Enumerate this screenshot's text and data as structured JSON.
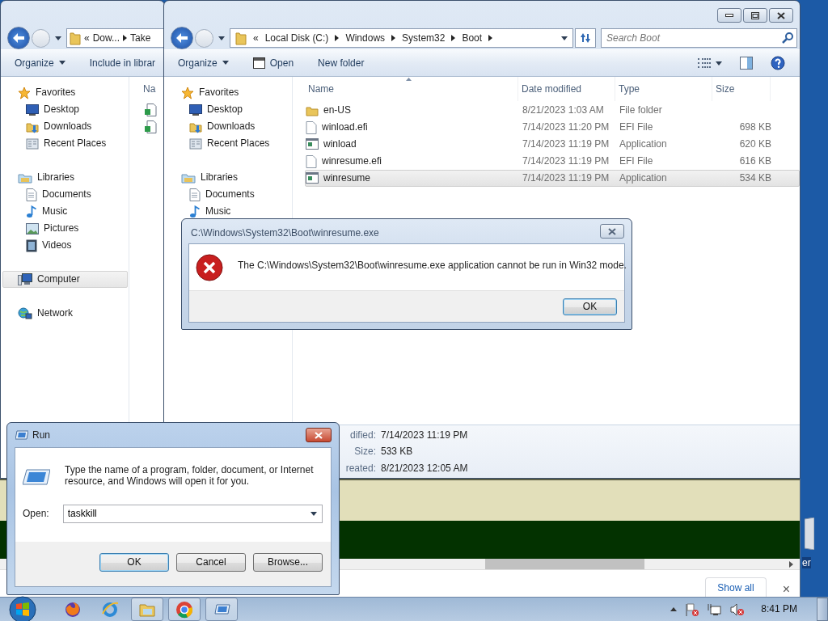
{
  "back_explorer": {
    "address": {
      "overflow": "«",
      "crumbs": [
        "Dow...",
        "Take"
      ]
    },
    "toolbar": [
      {
        "label": "Organize",
        "dropdown": true
      },
      {
        "label": "Include in librar",
        "dropdown": false
      }
    ],
    "nav": [
      {
        "label": "Favorites",
        "kind": "star",
        "selected": false,
        "children": [
          {
            "label": "Desktop",
            "kind": "desktop",
            "selected": false
          },
          {
            "label": "Downloads",
            "kind": "downloads",
            "selected": false
          },
          {
            "label": "Recent Places",
            "kind": "recent",
            "selected": false
          }
        ]
      },
      {
        "label": "Libraries",
        "kind": "library",
        "selected": false,
        "children": [
          {
            "label": "Documents",
            "kind": "documents",
            "selected": false
          },
          {
            "label": "Music",
            "kind": "music",
            "selected": false
          },
          {
            "label": "Pictures",
            "kind": "pictures",
            "selected": false
          },
          {
            "label": "Videos",
            "kind": "videos",
            "selected": false
          }
        ]
      },
      {
        "label": "Computer",
        "kind": "computer",
        "selected": true
      },
      {
        "label": "Network",
        "kind": "network",
        "selected": false
      }
    ],
    "column_1": "Na",
    "files": [
      {
        "kind": "script"
      },
      {
        "kind": "script"
      }
    ]
  },
  "front_explorer": {
    "address": {
      "overflow": "«",
      "crumbs": [
        "Local Disk (C:)",
        "Windows",
        "System32",
        "Boot"
      ]
    },
    "search": {
      "placeholder": "Search Boot"
    },
    "toolbar": [
      {
        "label": "Organize",
        "dropdown": true,
        "kind": "plain"
      },
      {
        "label": "Open",
        "dropdown": false,
        "kind": "open"
      },
      {
        "label": "New folder",
        "dropdown": false,
        "kind": "plain"
      }
    ],
    "nav": [
      {
        "label": "Favorites",
        "kind": "star",
        "selected": false,
        "children": [
          {
            "label": "Desktop",
            "kind": "desktop",
            "selected": false
          },
          {
            "label": "Downloads",
            "kind": "downloads",
            "selected": false
          },
          {
            "label": "Recent Places",
            "kind": "recent",
            "selected": false
          }
        ]
      },
      {
        "label": "Libraries",
        "kind": "library",
        "selected": false,
        "children": [
          {
            "label": "Documents",
            "kind": "documents",
            "selected": false
          },
          {
            "label": "Music",
            "kind": "music",
            "selected": false
          }
        ]
      }
    ],
    "columns": [
      "Name",
      "Date modified",
      "Type",
      "Size"
    ],
    "files": [
      {
        "name": "en-US",
        "kind": "folder",
        "date": "8/21/2023 1:03 AM",
        "type": "File folder",
        "selected": false
      },
      {
        "name": "winload.efi",
        "kind": "file",
        "date": "7/14/2023 11:20 PM",
        "type": "EFI File",
        "size": "698 KB",
        "selected": false
      },
      {
        "name": "winload",
        "kind": "app",
        "date": "7/14/2023 11:19 PM",
        "type": "Application",
        "size": "620 KB",
        "selected": false
      },
      {
        "name": "winresume.efi",
        "kind": "file",
        "date": "7/14/2023 11:19 PM",
        "type": "EFI File",
        "size": "616 KB",
        "selected": false
      },
      {
        "name": "winresume",
        "kind": "app",
        "date": "7/14/2023 11:19 PM",
        "type": "Application",
        "size": "534 KB",
        "selected": true
      }
    ],
    "details": [
      {
        "label": "dified:",
        "value": "7/14/2023 11:19 PM"
      },
      {
        "label": "Size:",
        "value": "533 KB"
      },
      {
        "label": "reated:",
        "value": "8/21/2023 12:05 AM"
      }
    ]
  },
  "error_dialog": {
    "title": "C:\\Windows\\System32\\Boot\\winresume.exe",
    "message": "The C:\\Windows\\System32\\Boot\\winresume.exe application cannot be run in Win32 mode.",
    "button": "OK"
  },
  "run_dialog": {
    "title": "Run",
    "prompt": "Type the name of a program, folder, document, or Internet resource, and Windows will open it for you.",
    "open_label": "Open:",
    "value": "taskkill",
    "buttons": [
      {
        "label": "OK",
        "default": true
      },
      {
        "label": "Cancel",
        "default": false
      },
      {
        "label": "Browse...",
        "default": false
      }
    ]
  },
  "browser_window": {
    "download_bar": {
      "show_all": "Show all",
      "close": "×"
    }
  },
  "desktop": {
    "icon_label": "er"
  },
  "taskbar": {
    "apps": [
      {
        "kind": "firefox",
        "running": false
      },
      {
        "kind": "ie",
        "running": false
      },
      {
        "kind": "explorer",
        "running": true
      },
      {
        "kind": "chrome",
        "running": true
      },
      {
        "kind": "run",
        "running": true
      }
    ],
    "clock": "8:41 PM"
  }
}
